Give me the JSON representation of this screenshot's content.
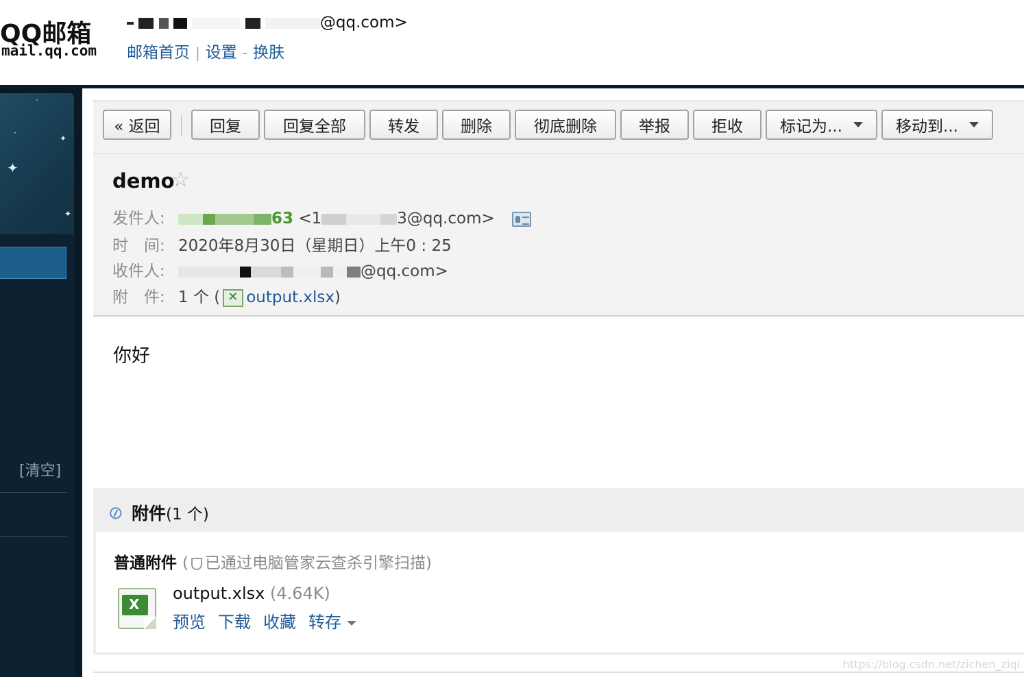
{
  "header": {
    "logo_main": "QQ邮箱",
    "logo_sub": "mail.qq.com",
    "user_email_suffix": "@qq.com>",
    "nav": {
      "home": "邮箱首页",
      "sep1": "|",
      "settings": "设置",
      "sep2": "-",
      "skin": "换肤"
    }
  },
  "sidebar": {
    "clear_label": "[清空]"
  },
  "toolbar": {
    "back": "« 返回",
    "reply": "回复",
    "reply_all": "回复全部",
    "forward": "转发",
    "delete": "删除",
    "delete_forever": "彻底删除",
    "report": "举报",
    "reject": "拒收",
    "mark_as": "标记为...",
    "move_to": "移动到..."
  },
  "mail": {
    "subject": "demo",
    "star_glyph": "☆",
    "from_label": "发件人:",
    "from_name_suffix": "63",
    "from_email_prefix": "<1",
    "from_email_suffix": "3@qq.com>",
    "time_label": "时　间:",
    "time_value": "2020年8月30日（星期日）上午0 : 25",
    "to_label": "收件人:",
    "to_email_suffix": "@qq.com>",
    "attach_label": "附　件:",
    "attach_count_prefix": "1 个 (",
    "attach_file": "output.xlsx",
    "attach_count_suffix": ")",
    "body": "你好"
  },
  "attachments": {
    "title": "附件",
    "count": "(1 个)",
    "type_label": "普通附件",
    "scan_open": "(",
    "scan_text": "已通过电脑管家云查杀引擎扫描)",
    "file_name": "output.xlsx",
    "file_size": "(4.64K)",
    "actions": {
      "preview": "预览",
      "download": "下载",
      "favorite": "收藏",
      "save_to": "转存"
    }
  },
  "watermark": "https://blog.csdn.net/zichen_ziqi"
}
